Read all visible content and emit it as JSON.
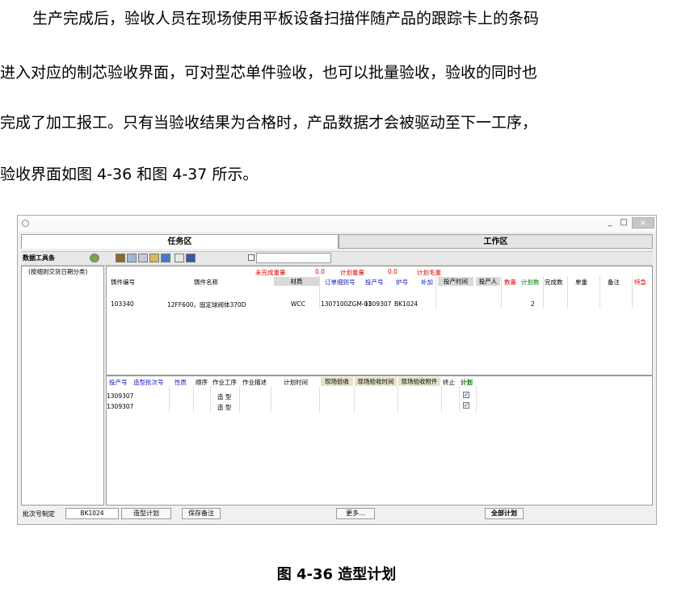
{
  "paragraphs": [
    "生产完成后，验收人员在现场使用平板设备扫描伴随产品的跟踪卡上的条码",
    "进入对应的制芯验收界面，可对型芯单件验收，也可以批量验收，验收的同时也",
    "完成了加工报工。只有当验收结果为合格时，产品数据才会被驱动至下一工序，",
    "验收界面如图 4-36 和图 4-37 所示。"
  ],
  "window": {
    "min_glyph": "_",
    "max_glyph": "□",
    "close_glyph": "×",
    "tabs": [
      "任务区",
      "工作区"
    ],
    "toolbar_label": "数据工具条",
    "left_pane_text": "(按细则交货日期分类)",
    "summary": {
      "unfinished_weight_label": "未完成重量",
      "unfinished_weight_value": "0.0",
      "plan_weight_label": "计划重量",
      "plan_weight_value": "0.0",
      "plan_gross_label": "计划毛重"
    },
    "upper_headers": {
      "casting_no": "铸件编号",
      "casting_name": "铸件名称",
      "material": "材质",
      "order_detail_no": "订单细则号",
      "production_no": "投产号",
      "heat_no": "炉号",
      "supplement": "补加",
      "production_time": "投产时间",
      "producer": "投产人",
      "quantity": "数量",
      "plan_qty": "计划数",
      "done_qty": "完成数",
      "unit_weight": "单重",
      "remark": "备注",
      "urgent": "特急"
    },
    "upper_row": {
      "casting_no": "103340",
      "casting_name": "12FF600，固定球阀体370D",
      "material": "WCC",
      "order_detail_no": "1307100ZGM-01",
      "production_no": "1309307",
      "heat_no": "BK1024",
      "plan_qty": "2"
    },
    "lower_headers": {
      "production_no": "投产号",
      "molding_batch_no": "造型批次号",
      "nature": "性质",
      "sequence": "顺序",
      "process": "作业工序",
      "description": "作业描述",
      "plan_time": "计划时间",
      "site_acceptance": "现场验收",
      "site_acceptance_time": "现场验收时间",
      "site_acceptance_attachment": "现场验收附件",
      "terminate": "终止",
      "plan": "计划"
    },
    "lower_rows": [
      {
        "production_no": "1309307",
        "process": "造 型"
      },
      {
        "production_no": "1309307",
        "process": "造 型"
      }
    ],
    "statusbar": {
      "batch_label": "批次号制定",
      "batch_value": "BK1024",
      "molding_plan_button": "造型计划",
      "save_remark_button": "保存备注",
      "more_button": "更多...",
      "all_plan_button": "全部计划"
    }
  },
  "caption": "图 4-36  造型计划"
}
